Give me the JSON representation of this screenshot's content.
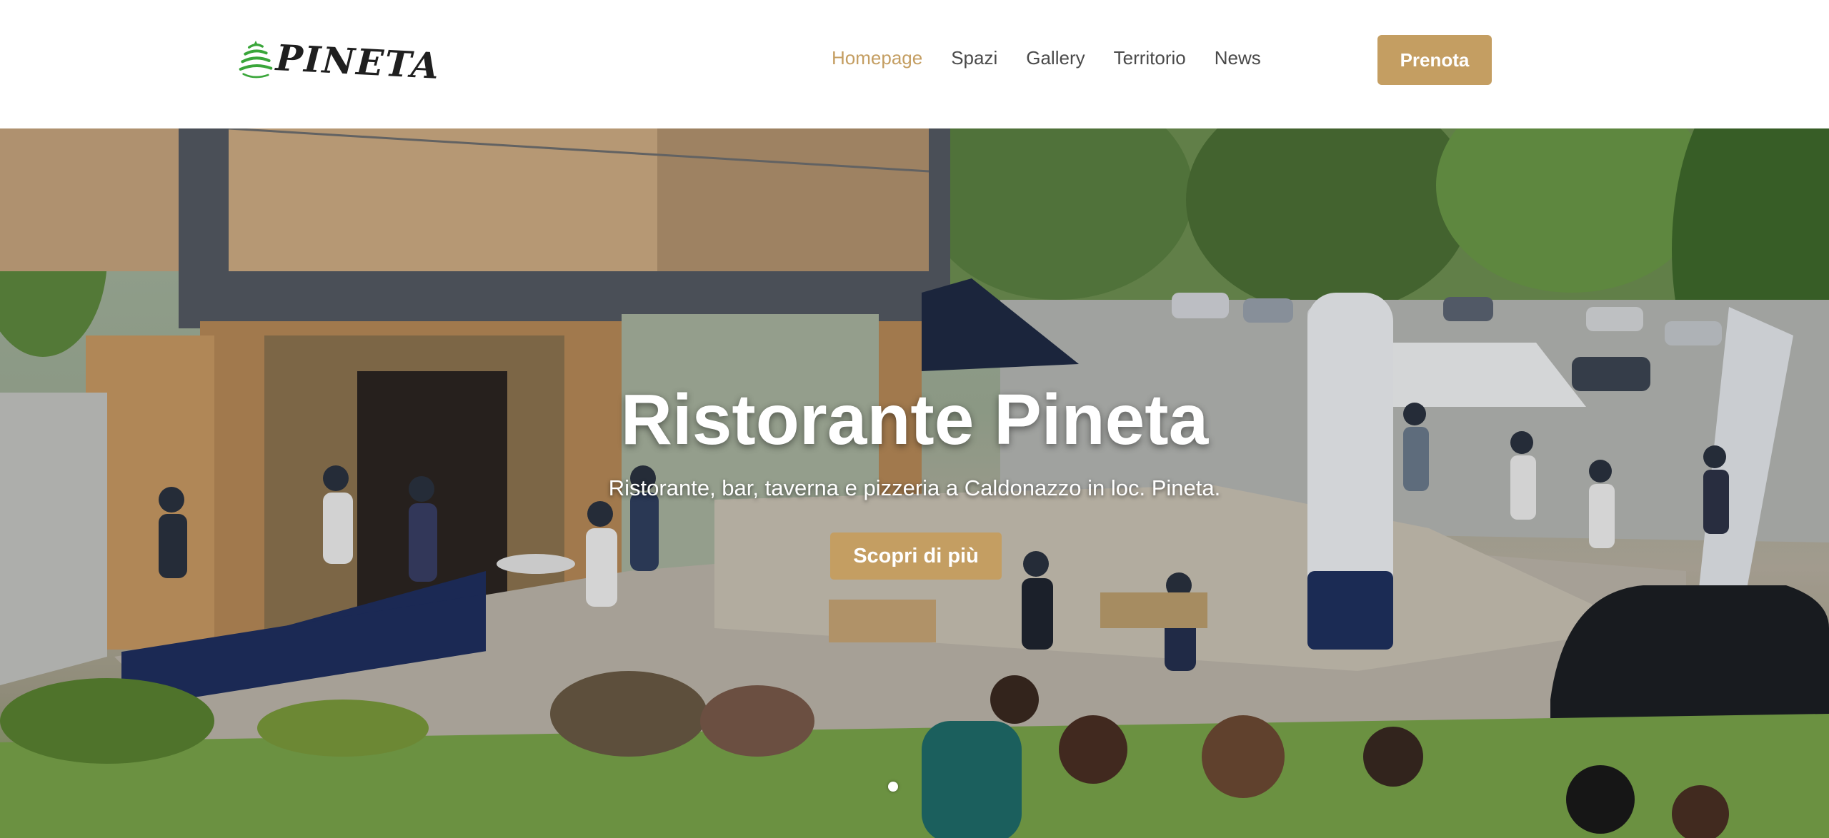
{
  "brand": {
    "name": "PINETA",
    "accent_color": "#c49e62",
    "logo_icon": "pine-tree-icon"
  },
  "nav": {
    "items": [
      {
        "label": "Homepage",
        "active": true
      },
      {
        "label": "Spazi",
        "active": false
      },
      {
        "label": "Gallery",
        "active": false
      },
      {
        "label": "Territorio",
        "active": false
      },
      {
        "label": "News",
        "active": false
      }
    ],
    "cta_label": "Prenota"
  },
  "hero": {
    "title": "Ristorante Pineta",
    "subtitle": "Ristorante, bar, taverna e pizzeria a Caldonazzo in loc. Pineta.",
    "cta_label": "Scopri di più",
    "slide_count": 1,
    "active_slide": 1
  }
}
